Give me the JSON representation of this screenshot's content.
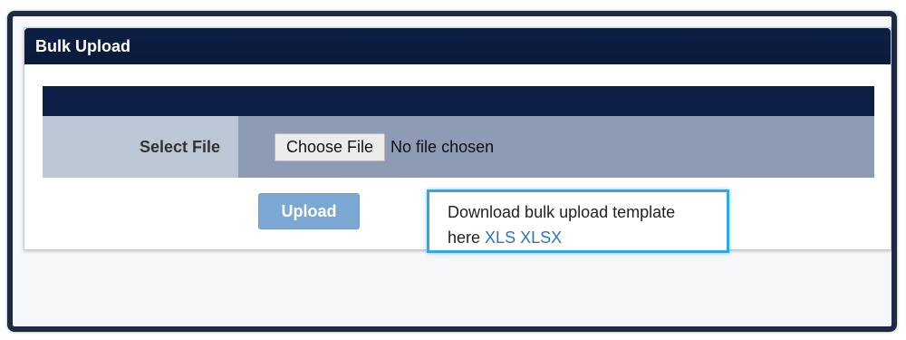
{
  "panel": {
    "title": "Bulk Upload"
  },
  "form": {
    "select_file_label": "Select File",
    "choose_file_label": "Choose File",
    "no_file_text": "No file chosen"
  },
  "actions": {
    "upload_label": "Upload"
  },
  "template": {
    "text_line1": "Download bulk upload template",
    "text_here": "here",
    "xls_link": "XLS",
    "xlsx_link": "XLSX"
  },
  "colors": {
    "header_bg": "#0d1f45",
    "label_bg": "#bcc6d4",
    "value_bg": "#8d9bb4",
    "upload_button": "#7ba7d3",
    "highlight_border": "#2fa8e8",
    "link": "#2a75b8"
  }
}
